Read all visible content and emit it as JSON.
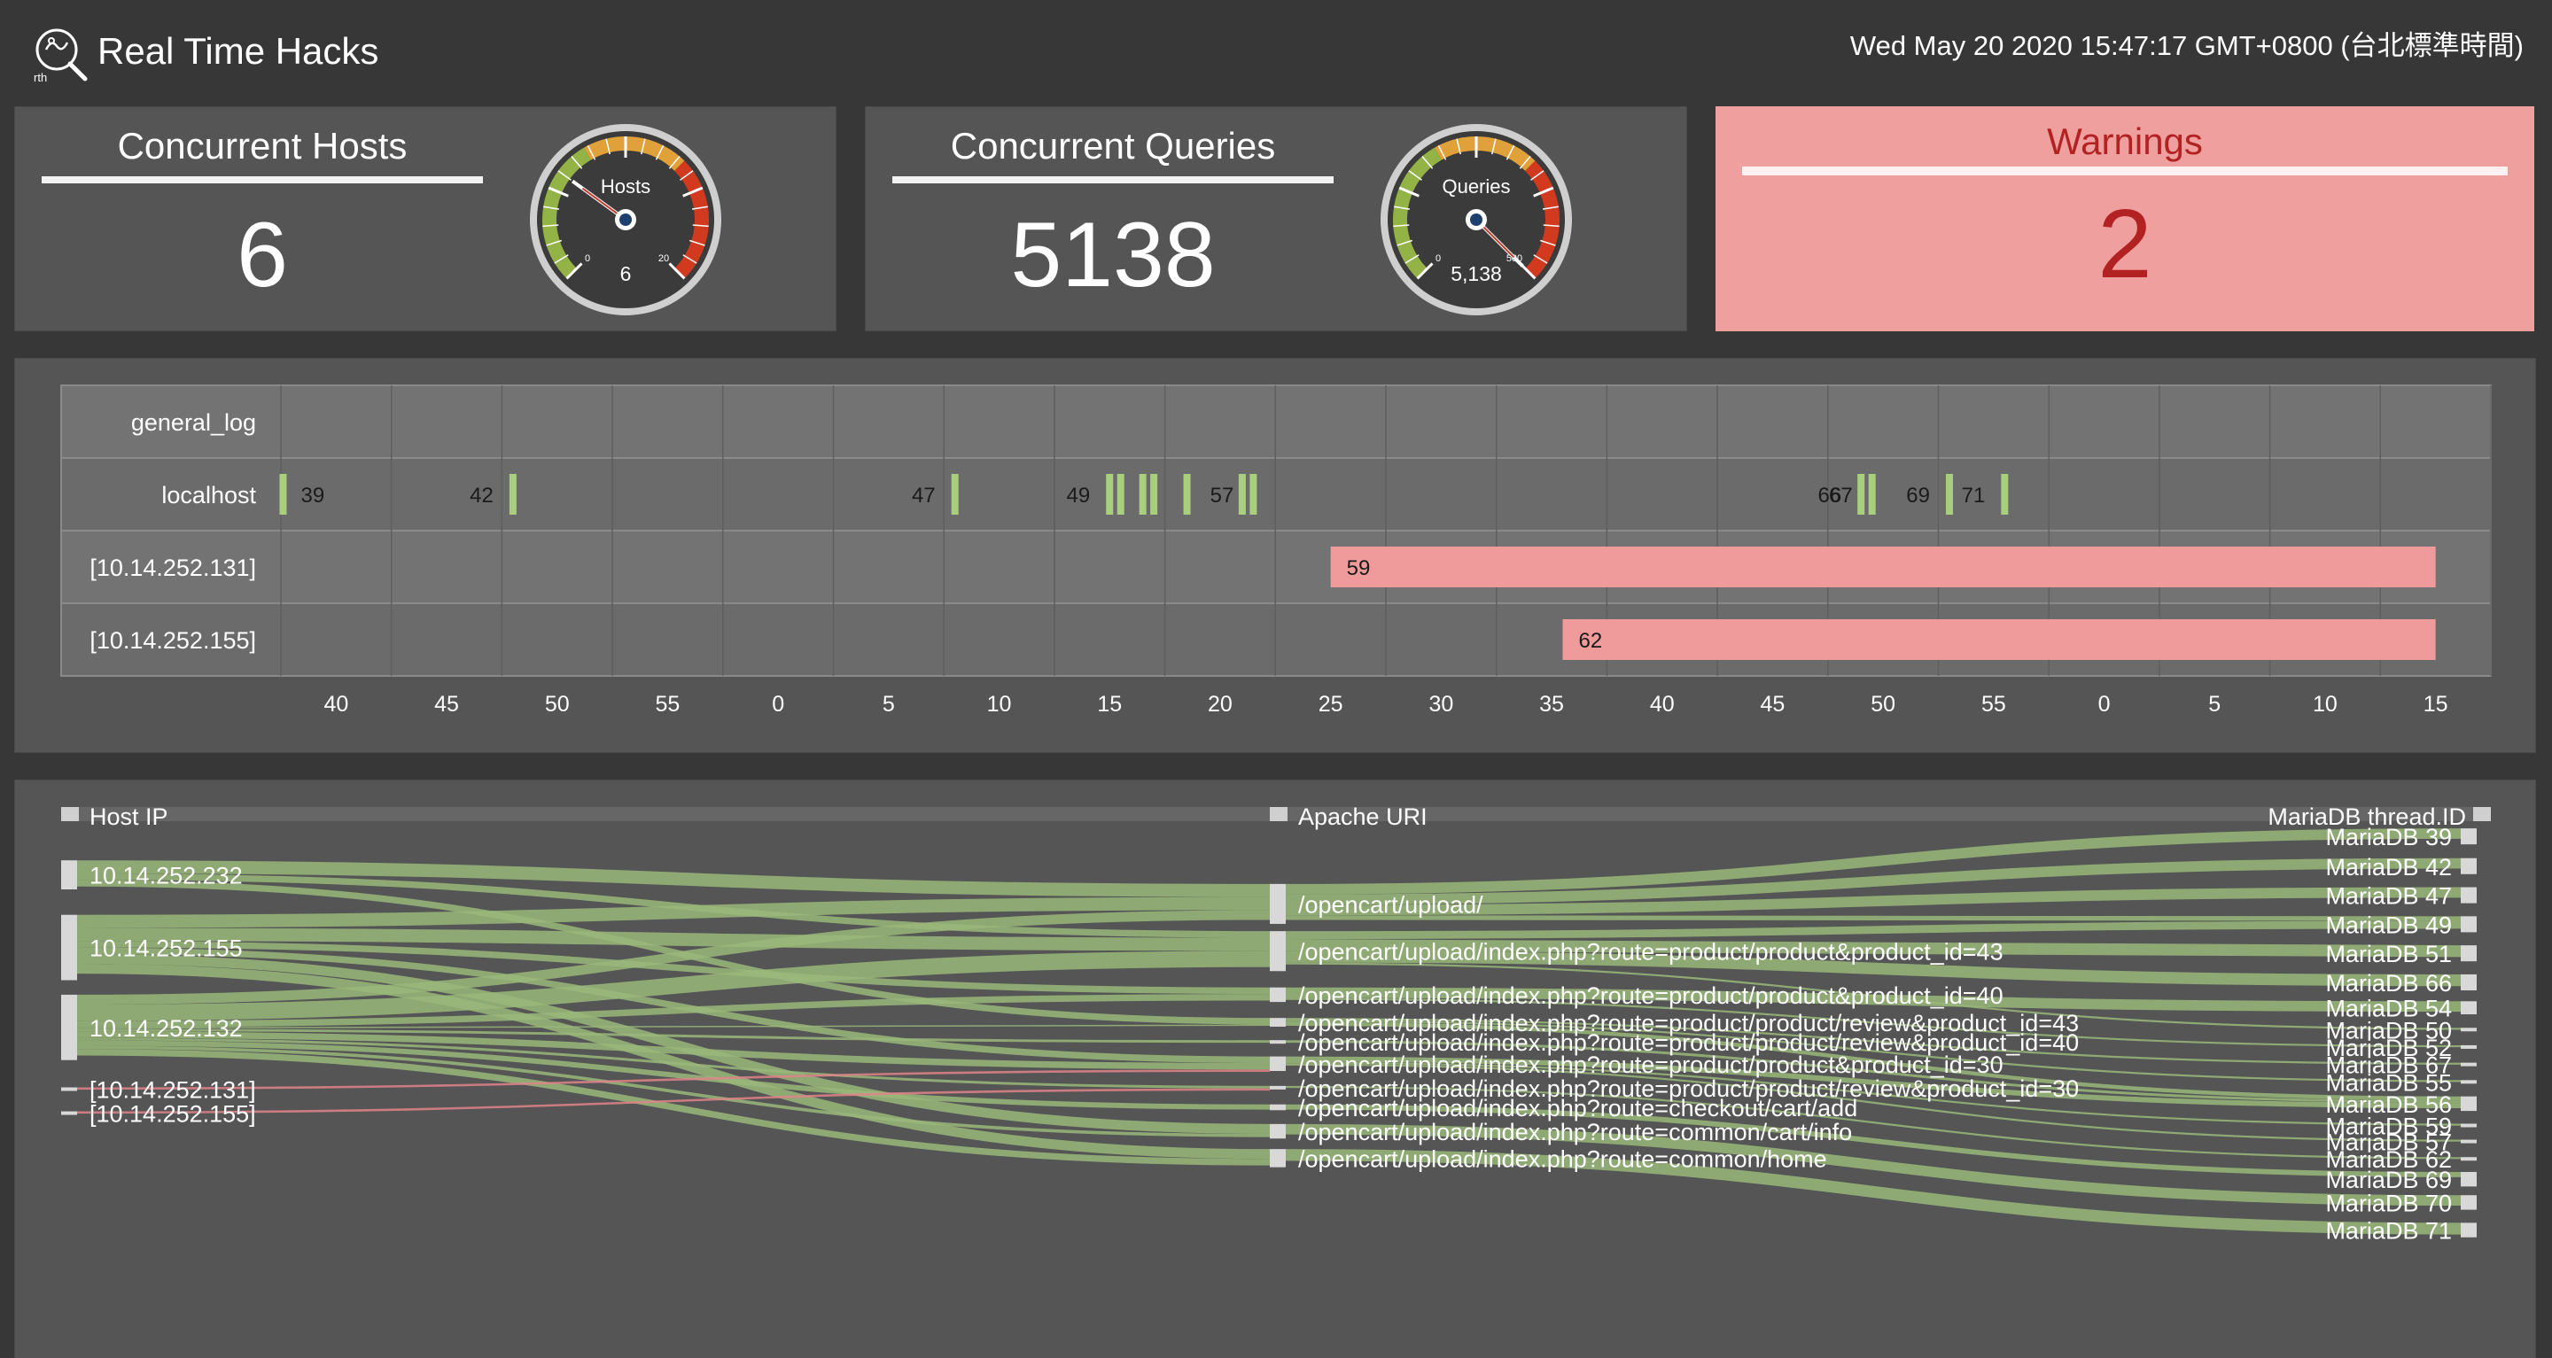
{
  "header": {
    "title": "Real Time Hacks",
    "logo_text": "rth",
    "datetime": "Wed May 20 2020 15:47:17 GMT+0800 (台北標準時間)"
  },
  "cards": {
    "hosts": {
      "title": "Concurrent Hosts",
      "value": "6",
      "gauge_label": "Hosts",
      "gauge_value": "6",
      "gauge_min": "0",
      "gauge_max": "20",
      "gauge_fraction": 0.3
    },
    "queries": {
      "title": "Concurrent Queries",
      "value": "5138",
      "gauge_label": "Queries",
      "gauge_value": "5,138",
      "gauge_min": "0",
      "gauge_max": "500",
      "gauge_fraction": 1.0
    },
    "warnings": {
      "title": "Warnings",
      "value": "2"
    }
  },
  "colors": {
    "background": "#373737",
    "panel": "#555555",
    "green": "#a9cf7e",
    "link_green": "#9ab87a",
    "warning_bg": "#f09f9f",
    "warning_text": "#b22222",
    "bar_red": "#ef9b9b"
  },
  "timeline": {
    "rows": [
      "general_log",
      "localhost",
      "[10.14.252.131]",
      "[10.14.252.155]"
    ],
    "axis_ticks": [
      "40",
      "45",
      "50",
      "55",
      "0",
      "5",
      "10",
      "15",
      "20",
      "25",
      "30",
      "35",
      "40",
      "45",
      "50",
      "55",
      "0",
      "5",
      "10",
      "15"
    ],
    "localhost_events": [
      {
        "t": 0.1,
        "label": "39"
      },
      {
        "t": 10.5,
        "label": "42"
      },
      {
        "t": 30.5,
        "label": "47"
      },
      {
        "t": 37.5,
        "label": "49"
      },
      {
        "t": 38.0,
        "label": ""
      },
      {
        "t": 39.0,
        "label": ""
      },
      {
        "t": 39.5,
        "label": ""
      },
      {
        "t": 41.0,
        "label": ""
      },
      {
        "t": 43.5,
        "label": ""
      },
      {
        "t": 44.0,
        "label": "57"
      },
      {
        "t": 71.5,
        "label": "66"
      },
      {
        "t": 72.0,
        "label": "67"
      },
      {
        "t": 75.5,
        "label": "69"
      },
      {
        "t": 78.0,
        "label": "71"
      }
    ],
    "bars": [
      {
        "row": 2,
        "start": 47.5,
        "end": 97.5,
        "label": "59"
      },
      {
        "row": 3,
        "start": 58.0,
        "end": 97.5,
        "label": "62"
      }
    ]
  },
  "sankey": {
    "headers": [
      "Host IP",
      "Apache URI",
      "MariaDB thread.ID"
    ],
    "hosts": [
      {
        "label": "10.14.252.232",
        "center": 13.0,
        "size": 4.0,
        "link": "green"
      },
      {
        "label": "10.14.252.155",
        "center": 23.0,
        "size": 9.0,
        "link": "green"
      },
      {
        "label": "10.14.252.132",
        "center": 34.0,
        "size": 9.0,
        "link": "green"
      },
      {
        "label": "[10.14.252.131]",
        "center": 42.5,
        "size": 0.35,
        "link": "red"
      },
      {
        "label": "[10.14.252.155]",
        "center": 45.8,
        "size": 0.35,
        "link": "red"
      }
    ],
    "uris": [
      {
        "label": "/opencart/upload/",
        "center": 17.0,
        "size": 5.5
      },
      {
        "label": "/opencart/upload/index.php?route=product/product&product_id=43",
        "center": 23.5,
        "size": 5.5
      },
      {
        "label": "/opencart/upload/index.php?route=product/product&product_id=40",
        "center": 29.5,
        "size": 2.0
      },
      {
        "label": "/opencart/upload/index.php?route=product/product/review&product_id=43",
        "center": 33.3,
        "size": 1.2
      },
      {
        "label": "/opencart/upload/index.php?route=product/product/review&product_id=40",
        "center": 36.0,
        "size": 0.4
      },
      {
        "label": "/opencart/upload/index.php?route=product/product&product_id=30",
        "center": 39.0,
        "size": 2.0
      },
      {
        "label": "/opencart/upload/index.php?route=product/product/review&product_id=30",
        "center": 42.3,
        "size": 0.4
      },
      {
        "label": "/opencart/upload/index.php?route=checkout/cart/add",
        "center": 45.0,
        "size": 0.8
      },
      {
        "label": "/opencart/upload/index.php?route=common/cart/info",
        "center": 48.3,
        "size": 2.0
      },
      {
        "label": "/opencart/upload/index.php?route=common/home",
        "center": 52.0,
        "size": 2.5
      }
    ],
    "threads": [
      {
        "label": "MariaDB 39",
        "center": 7.7,
        "size": 2.2
      },
      {
        "label": "MariaDB 42",
        "center": 11.8,
        "size": 2.2
      },
      {
        "label": "MariaDB 47",
        "center": 15.8,
        "size": 2.2
      },
      {
        "label": "MariaDB 49",
        "center": 19.8,
        "size": 2.2
      },
      {
        "label": "MariaDB 51",
        "center": 23.8,
        "size": 2.2
      },
      {
        "label": "MariaDB 66",
        "center": 27.8,
        "size": 2.2
      },
      {
        "label": "MariaDB 54",
        "center": 31.3,
        "size": 1.8
      },
      {
        "label": "MariaDB 50",
        "center": 34.3,
        "size": 0.3
      },
      {
        "label": "MariaDB 52",
        "center": 36.7,
        "size": 0.3
      },
      {
        "label": "MariaDB 67",
        "center": 39.1,
        "size": 0.3
      },
      {
        "label": "MariaDB 55",
        "center": 41.5,
        "size": 0.3
      },
      {
        "label": "MariaDB 56",
        "center": 44.5,
        "size": 2.0
      },
      {
        "label": "MariaDB 59",
        "center": 47.5,
        "size": 0.3
      },
      {
        "label": "MariaDB 57",
        "center": 49.7,
        "size": 0.3
      },
      {
        "label": "MariaDB 62",
        "center": 52.1,
        "size": 0.3
      },
      {
        "label": "MariaDB 69",
        "center": 54.9,
        "size": 2.0
      },
      {
        "label": "MariaDB 70",
        "center": 58.1,
        "size": 2.0
      },
      {
        "label": "MariaDB 71",
        "center": 61.9,
        "size": 2.0
      }
    ],
    "flows": [
      {
        "from": 0,
        "to": 0,
        "w": 2.0
      },
      {
        "from": 0,
        "to": 1,
        "w": 1.0
      },
      {
        "from": 0,
        "to": 3,
        "w": 1.0
      },
      {
        "from": 1,
        "to": 0,
        "w": 2.0
      },
      {
        "from": 1,
        "to": 1,
        "w": 2.0
      },
      {
        "from": 1,
        "to": 2,
        "w": 1.0
      },
      {
        "from": 1,
        "to": 5,
        "w": 1.0
      },
      {
        "from": 1,
        "to": 8,
        "w": 1.5
      },
      {
        "from": 1,
        "to": 9,
        "w": 1.5
      },
      {
        "from": 2,
        "to": 0,
        "w": 1.5
      },
      {
        "from": 2,
        "to": 1,
        "w": 2.5
      },
      {
        "from": 2,
        "to": 2,
        "w": 1.0
      },
      {
        "from": 2,
        "to": 3,
        "w": 0.2
      },
      {
        "from": 2,
        "to": 4,
        "w": 0.4
      },
      {
        "from": 2,
        "to": 5,
        "w": 1.0
      },
      {
        "from": 2,
        "to": 6,
        "w": 0.4
      },
      {
        "from": 2,
        "to": 7,
        "w": 0.8
      },
      {
        "from": 2,
        "to": 8,
        "w": 0.5
      },
      {
        "from": 2,
        "to": 9,
        "w": 1.0
      },
      {
        "from": 3,
        "to": 5,
        "w": 0.35
      },
      {
        "from": 4,
        "to": 6,
        "w": 0.35
      }
    ],
    "right_flows": [
      {
        "from": 0,
        "to": 0,
        "w": 1.6
      },
      {
        "from": 0,
        "to": 1,
        "w": 1.6
      },
      {
        "from": 0,
        "to": 2,
        "w": 1.6
      },
      {
        "from": 0,
        "to": 3,
        "w": 0.7
      },
      {
        "from": 1,
        "to": 3,
        "w": 1.2
      },
      {
        "from": 1,
        "to": 4,
        "w": 1.8
      },
      {
        "from": 1,
        "to": 5,
        "w": 1.8
      },
      {
        "from": 1,
        "to": 7,
        "w": 0.3
      },
      {
        "from": 2,
        "to": 6,
        "w": 1.6
      },
      {
        "from": 2,
        "to": 8,
        "w": 0.3
      },
      {
        "from": 3,
        "to": 9,
        "w": 0.3
      },
      {
        "from": 3,
        "to": 10,
        "w": 0.3
      },
      {
        "from": 3,
        "to": 11,
        "w": 0.6
      },
      {
        "from": 4,
        "to": 11,
        "w": 0.4
      },
      {
        "from": 5,
        "to": 11,
        "w": 0.8
      },
      {
        "from": 5,
        "to": 12,
        "w": 0.3
      },
      {
        "from": 5,
        "to": 13,
        "w": 0.3
      },
      {
        "from": 6,
        "to": 14,
        "w": 0.3
      },
      {
        "from": 7,
        "to": 15,
        "w": 0.8
      },
      {
        "from": 8,
        "to": 16,
        "w": 1.6
      },
      {
        "from": 9,
        "to": 17,
        "w": 1.8
      }
    ]
  }
}
